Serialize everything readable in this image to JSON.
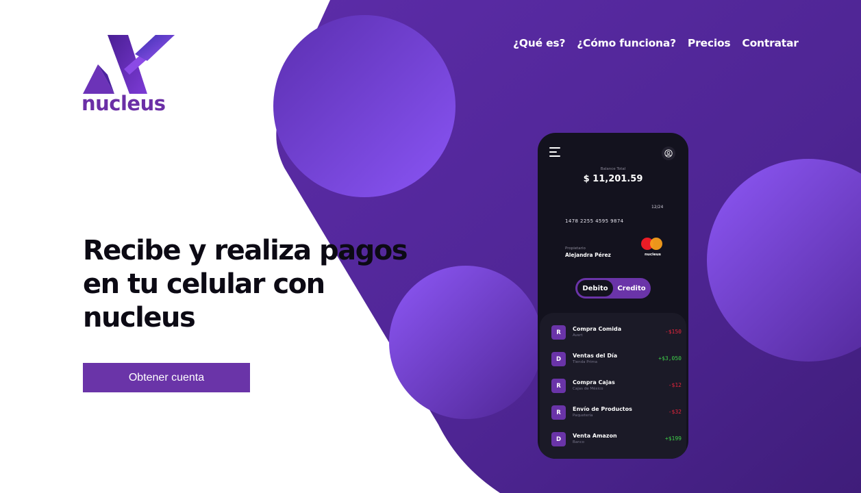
{
  "brand": {
    "name": "nucleus"
  },
  "nav": [
    "¿Qué es?",
    "¿Cómo funciona?",
    "Precios",
    "Contratar"
  ],
  "hero": {
    "title_lines": [
      "Recibe y realiza pagos",
      "en tu celular con",
      "nucleus"
    ],
    "cta": "Obtener cuenta"
  },
  "phone": {
    "balance_label": "Balance Total",
    "balance": "$ 11,201.59",
    "card": {
      "expiry": "12/24",
      "number": "1478 2255 4595 9874",
      "owner_label": "Propietario",
      "owner": "Alejandra Pérez",
      "brand": "nucleus"
    },
    "toggle": {
      "debit": "Debito",
      "credit": "Credito"
    },
    "transactions": [
      {
        "badge": "R",
        "title": "Compra Comida",
        "subtitle": "Avert",
        "amount": "-$150",
        "type": "neg"
      },
      {
        "badge": "D",
        "title": "Ventas del Día",
        "subtitle": "Tienda Prima",
        "amount": "+$3,050",
        "type": "pos"
      },
      {
        "badge": "R",
        "title": "Compra Cajas",
        "subtitle": "Cajas de México",
        "amount": "-$12",
        "type": "neg"
      },
      {
        "badge": "R",
        "title": "Envío de Productos",
        "subtitle": "Paquetería",
        "amount": "-$32",
        "type": "neg"
      },
      {
        "badge": "D",
        "title": "Venta Amazon",
        "subtitle": "Banco",
        "amount": "+$199",
        "type": "pos"
      }
    ]
  },
  "colors": {
    "primary": "#6a34a8",
    "background_purple": "#5a2a9e",
    "accent_light": "#8b55f0",
    "phone_bg": "#13121e",
    "negative": "#e8253c",
    "positive": "#3fd04a"
  }
}
